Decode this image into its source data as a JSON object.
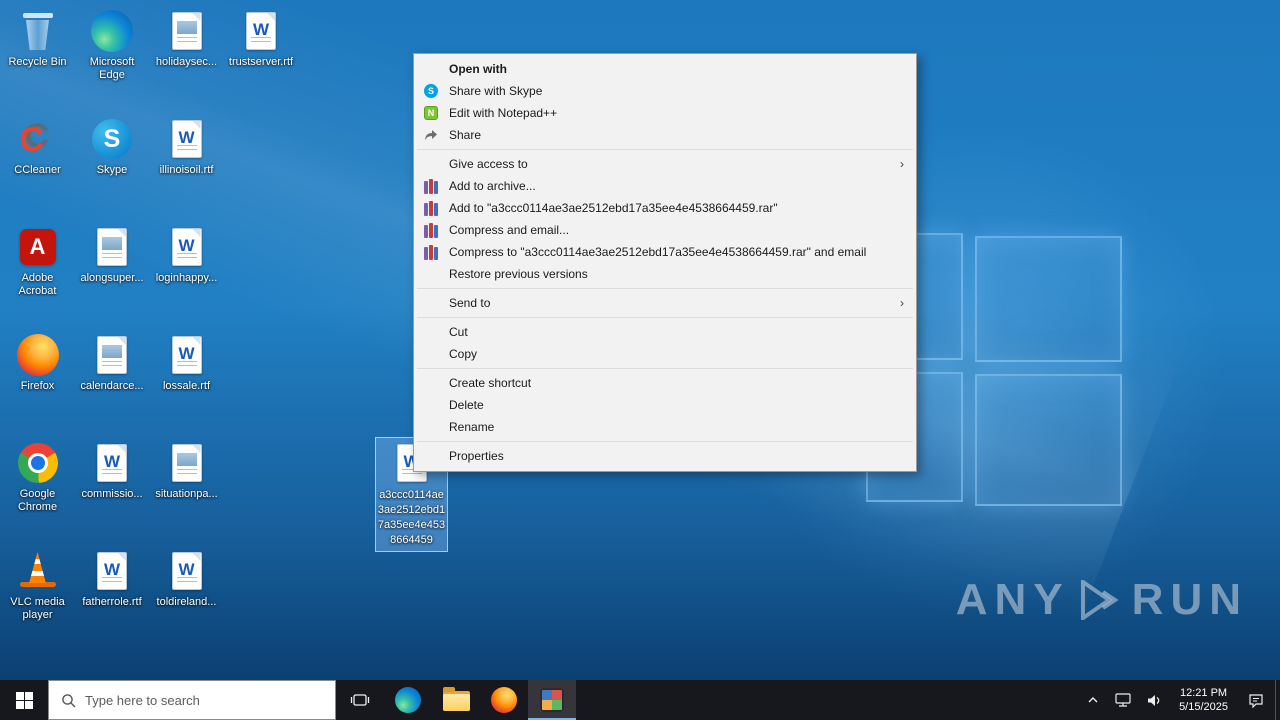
{
  "desktop": {
    "icons": [
      {
        "id": "recycle-bin",
        "label": "Recycle Bin",
        "kind": "recycle",
        "col": 0,
        "row": 0
      },
      {
        "id": "ccleaner",
        "label": "CCleaner",
        "kind": "ccleaner",
        "col": 0,
        "row": 1
      },
      {
        "id": "adobe-acrobat",
        "label": "Adobe Acrobat",
        "kind": "acrobat",
        "col": 0,
        "row": 2
      },
      {
        "id": "firefox",
        "label": "Firefox",
        "kind": "firefox",
        "col": 0,
        "row": 3
      },
      {
        "id": "google-chrome",
        "label": "Google Chrome",
        "kind": "chrome",
        "col": 0,
        "row": 4
      },
      {
        "id": "vlc-media-player",
        "label": "VLC media player",
        "kind": "vlc",
        "col": 0,
        "row": 5
      },
      {
        "id": "microsoft-edge",
        "label": "Microsoft Edge",
        "kind": "edge",
        "col": 1,
        "row": 0
      },
      {
        "id": "skype",
        "label": "Skype",
        "kind": "skype",
        "col": 1,
        "row": 1
      },
      {
        "id": "alongsuper",
        "label": "alongsuper...",
        "kind": "textdoc",
        "col": 1,
        "row": 2
      },
      {
        "id": "calendarce",
        "label": "calendarce...",
        "kind": "textdoc",
        "col": 1,
        "row": 3
      },
      {
        "id": "commissio",
        "label": "commissio...",
        "kind": "worddoc",
        "col": 1,
        "row": 4
      },
      {
        "id": "fatherrole",
        "label": "fatherrole.rtf",
        "kind": "worddoc",
        "col": 1,
        "row": 5
      },
      {
        "id": "holidaysec",
        "label": "holidaysec...",
        "kind": "textdoc",
        "col": 2,
        "row": 0
      },
      {
        "id": "illinoisoil",
        "label": "illinoisoil.rtf",
        "kind": "worddoc",
        "col": 2,
        "row": 1
      },
      {
        "id": "loginhappy",
        "label": "loginhappy...",
        "kind": "worddoc",
        "col": 2,
        "row": 2
      },
      {
        "id": "lossale",
        "label": "lossale.rtf",
        "kind": "worddoc",
        "col": 2,
        "row": 3
      },
      {
        "id": "situationpa",
        "label": "situationpa...",
        "kind": "textdoc",
        "col": 2,
        "row": 4
      },
      {
        "id": "toldireland",
        "label": "toldireland...",
        "kind": "worddoc",
        "col": 2,
        "row": 5
      },
      {
        "id": "trustserver",
        "label": "trustserver.rtf",
        "kind": "worddoc",
        "col": 3,
        "row": 0
      }
    ],
    "selected_file": {
      "label": "a3ccc0114ae3ae2512ebd17a35ee4e4538664459",
      "kind": "worddoc"
    }
  },
  "context_menu": {
    "items": [
      {
        "label": "Open with",
        "bold": true
      },
      {
        "label": "Share with Skype",
        "icon": "skype"
      },
      {
        "label": "Edit with Notepad++",
        "icon": "notepadpp"
      },
      {
        "label": "Share",
        "icon": "share"
      },
      {
        "separator": true
      },
      {
        "label": "Give access to",
        "submenu": true
      },
      {
        "label": "Add to archive...",
        "icon": "winrar"
      },
      {
        "label": "Add to \"a3ccc0114ae3ae2512ebd17a35ee4e4538664459.rar\"",
        "icon": "winrar"
      },
      {
        "label": "Compress and email...",
        "icon": "winrar"
      },
      {
        "label": "Compress to \"a3ccc0114ae3ae2512ebd17a35ee4e4538664459.rar\" and email",
        "icon": "winrar"
      },
      {
        "label": "Restore previous versions"
      },
      {
        "separator": true
      },
      {
        "label": "Send to",
        "submenu": true
      },
      {
        "separator": true
      },
      {
        "label": "Cut"
      },
      {
        "label": "Copy"
      },
      {
        "separator": true
      },
      {
        "label": "Create shortcut"
      },
      {
        "label": "Delete"
      },
      {
        "label": "Rename"
      },
      {
        "separator": true
      },
      {
        "label": "Properties"
      }
    ],
    "submenu_arrow": "›"
  },
  "taskbar": {
    "search_placeholder": "Type here to search",
    "clock": {
      "time": "12:21 PM",
      "date": "5/15/2025"
    }
  },
  "watermark": {
    "left": "ANY",
    "right": "RUN"
  },
  "colors": {
    "wallpaper_blue": "#1e78bd",
    "taskbar_bg": "#17171e",
    "menu_bg": "#f2f2f2",
    "selection": "#73afeb",
    "active_app_underline": "#76b9ed"
  }
}
